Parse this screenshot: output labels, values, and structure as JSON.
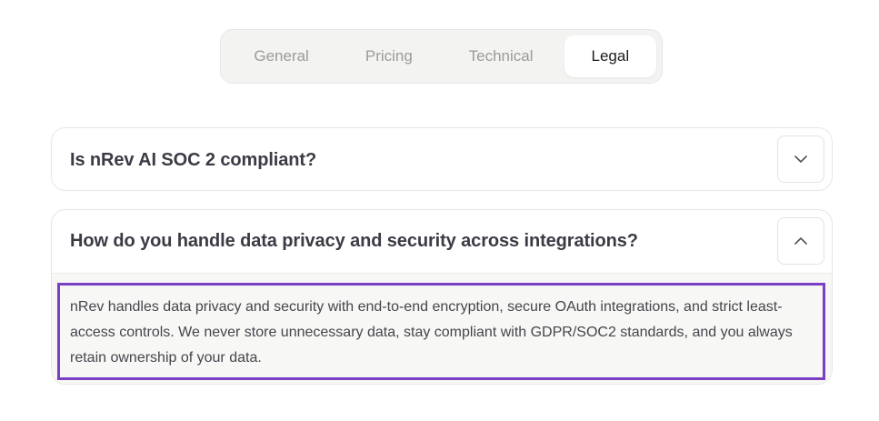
{
  "tabs": [
    {
      "label": "General",
      "active": false
    },
    {
      "label": "Pricing",
      "active": false
    },
    {
      "label": "Technical",
      "active": false
    },
    {
      "label": "Legal",
      "active": true
    }
  ],
  "faqs": [
    {
      "question": "Is nRev AI SOC 2 compliant?",
      "expanded": false,
      "toggle_icon": "chevron-down-icon"
    },
    {
      "question": "How do you handle data privacy and security across integrations?",
      "expanded": true,
      "toggle_icon": "chevron-up-icon",
      "answer": "nRev handles data privacy and security with end-to-end encryption, secure OAuth integrations, and strict least-access controls. We never store unnecessary data, stay compliant with GDPR/SOC2 standards, and you always retain ownership of your data."
    }
  ],
  "colors": {
    "focus_outline": "#7b3fc4",
    "tab_bar_bg": "#f3f3f1",
    "answer_bg": "#f7f7f5",
    "question_text": "#3b3b45"
  }
}
